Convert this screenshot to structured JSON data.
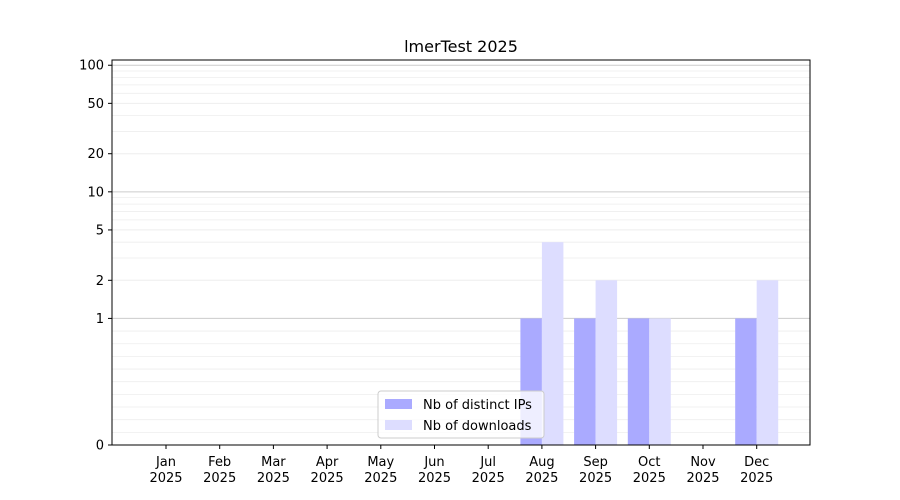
{
  "chart_data": {
    "type": "bar",
    "title": "lmerTest 2025",
    "xlabel": "",
    "ylabel": "",
    "yscale": "symlog",
    "ylim": [
      0,
      110
    ],
    "yticks": [
      0,
      1,
      2,
      5,
      10,
      20,
      50,
      100
    ],
    "ytick_labels": [
      "0",
      "1",
      "2",
      "5",
      "10",
      "20",
      "50",
      "100"
    ],
    "grid": "horizontal",
    "legend_position": "lower-center",
    "categories": [
      [
        "Jan",
        "2025"
      ],
      [
        "Feb",
        "2025"
      ],
      [
        "Mar",
        "2025"
      ],
      [
        "Apr",
        "2025"
      ],
      [
        "May",
        "2025"
      ],
      [
        "Jun",
        "2025"
      ],
      [
        "Jul",
        "2025"
      ],
      [
        "Aug",
        "2025"
      ],
      [
        "Sep",
        "2025"
      ],
      [
        "Oct",
        "2025"
      ],
      [
        "Nov",
        "2025"
      ],
      [
        "Dec",
        "2025"
      ]
    ],
    "series": [
      {
        "name": "Nb of distinct IPs",
        "color": "#aaaaff",
        "values": [
          0,
          0,
          0,
          0,
          0,
          0,
          0,
          1,
          1,
          1,
          0,
          1
        ]
      },
      {
        "name": "Nb of downloads",
        "color": "#ddddff",
        "values": [
          0,
          0,
          0,
          0,
          0,
          0,
          0,
          4,
          2,
          1,
          0,
          2
        ]
      }
    ]
  }
}
